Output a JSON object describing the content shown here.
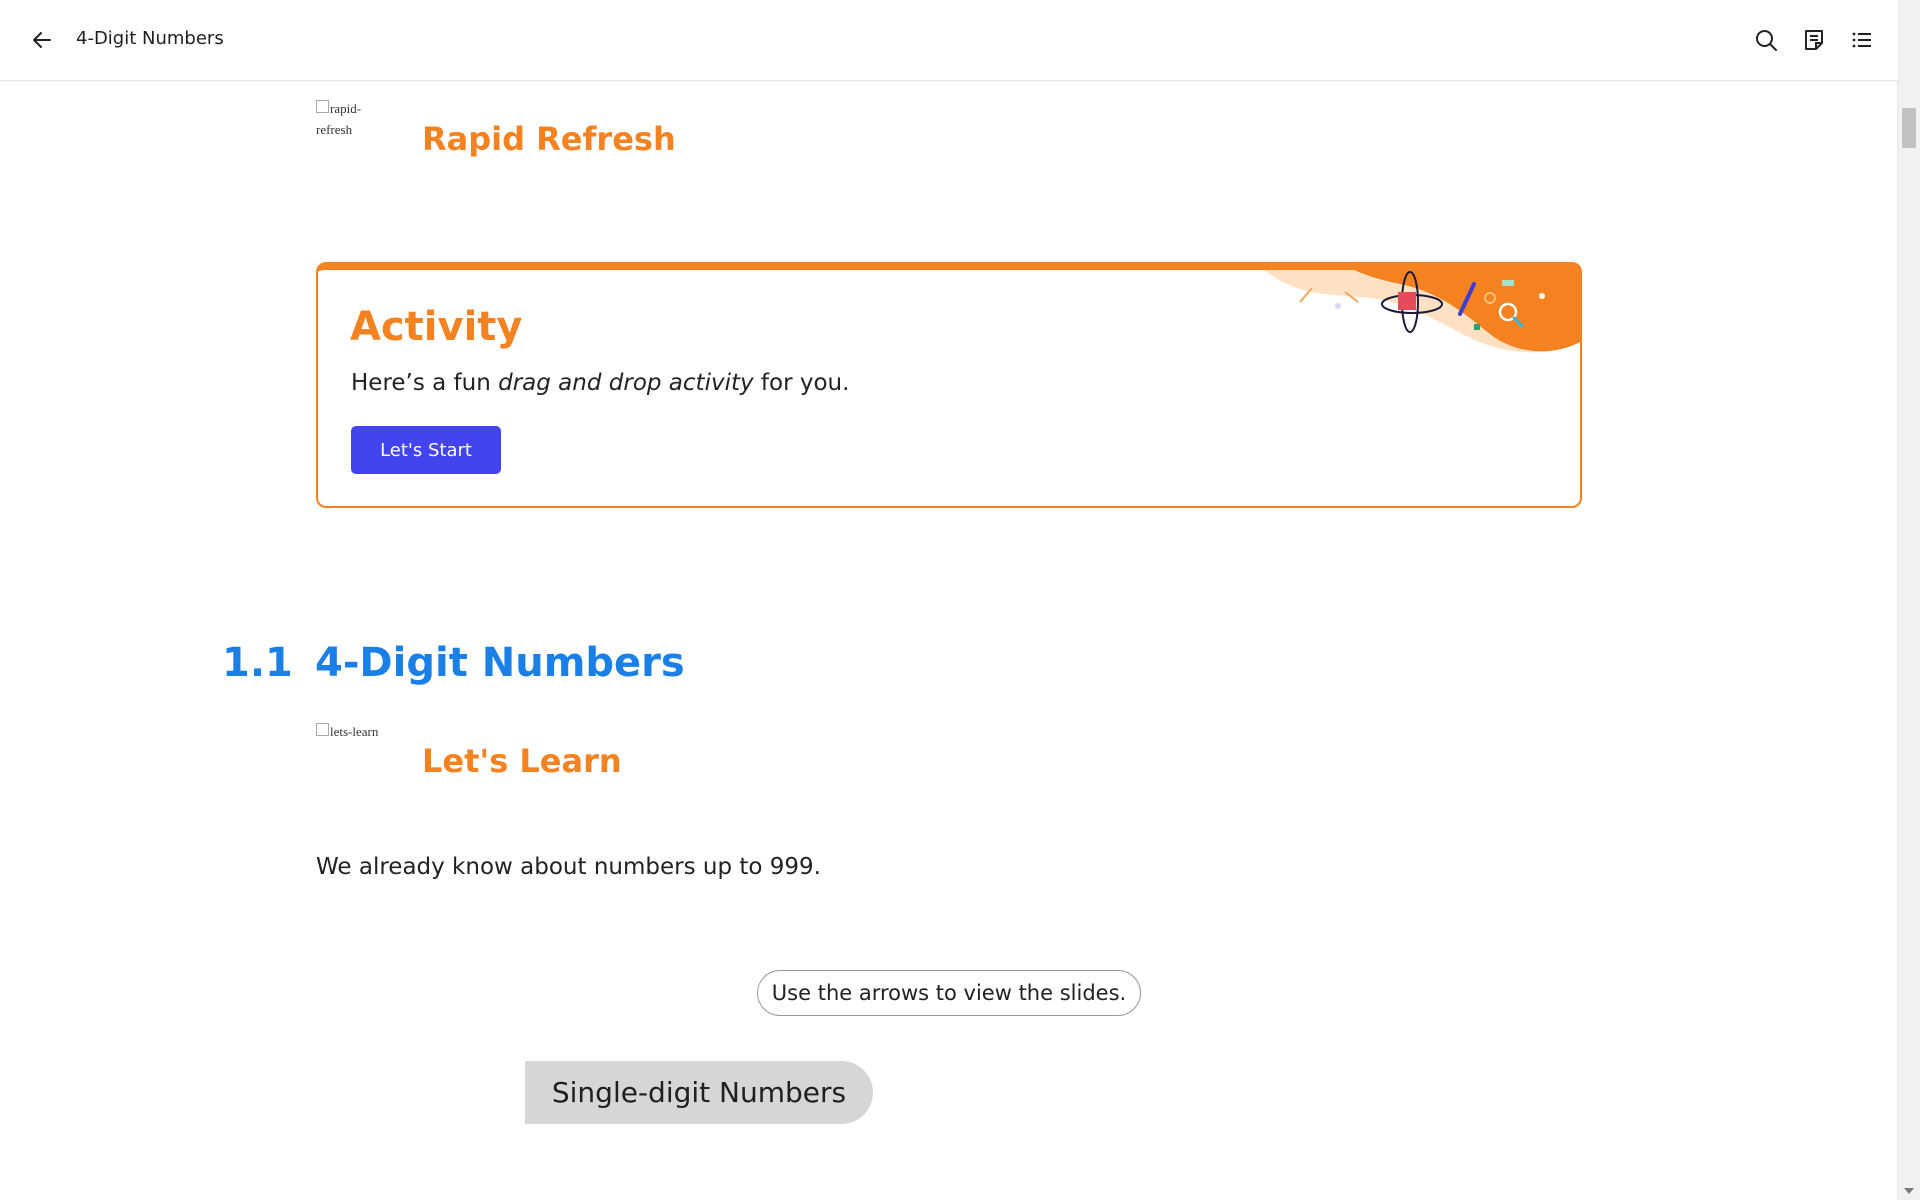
{
  "header": {
    "title": "4-Digit Numbers",
    "icons": [
      "back-arrow-icon",
      "search-icon",
      "notes-icon",
      "list-icon"
    ]
  },
  "rapid_refresh": {
    "img_alt_line1": "rapid-",
    "img_alt_line2": "refresh",
    "label": "Rapid Refresh"
  },
  "activity": {
    "title": "Activity",
    "desc_prefix": "Here’s a fun ",
    "desc_emphasis": "drag and drop activity",
    "desc_suffix": " for you.",
    "button_label": "Let's Start"
  },
  "section": {
    "number": "1.1",
    "title": "4-Digit Numbers"
  },
  "lets_learn": {
    "img_alt": "lets-learn",
    "label": "Let's Learn"
  },
  "content": {
    "intro": "We already know about numbers up to 999.",
    "hint": "Use the arrows to view the slides.",
    "slide_tab": "Single-digit Numbers"
  },
  "colors": {
    "accent_orange": "#f58220",
    "heading_blue": "#1a7fe6",
    "button_blue": "#4343f0"
  }
}
